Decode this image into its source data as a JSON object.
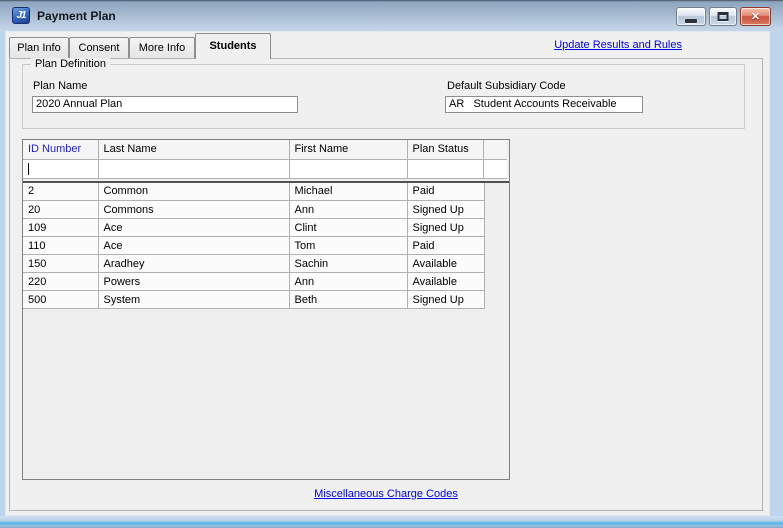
{
  "window": {
    "title": "Payment Plan",
    "app_icon_text": "J1",
    "controls": {
      "minimize": "minimize-icon",
      "maximize": "maximize-icon",
      "close_glyph": "✕"
    }
  },
  "tabs": [
    {
      "label": "Plan Info",
      "selected": false
    },
    {
      "label": "Consent",
      "selected": false
    },
    {
      "label": "More Info",
      "selected": false
    },
    {
      "label": "Students",
      "selected": true
    }
  ],
  "links": {
    "update_results_and_rules": "Update Results and Rules",
    "miscellaneous_charge_codes": "Miscellaneous Charge Codes"
  },
  "plan_definition": {
    "group_title": "Plan Definition",
    "plan_name_label": "Plan Name",
    "plan_name_value": "2020 Annual Plan",
    "subsidiary_label": "Default Subsidiary Code",
    "subsidiary_value": "AR   Student Accounts Receivable"
  },
  "students_grid": {
    "columns": [
      "ID Number",
      "Last Name",
      "First Name",
      "Plan Status"
    ],
    "sorted_column": "ID Number",
    "filter_values": [
      "",
      "",
      "",
      ""
    ],
    "rows": [
      [
        "2",
        "Common",
        "Michael",
        "Paid"
      ],
      [
        "20",
        "Commons",
        "Ann",
        "Signed Up"
      ],
      [
        "109",
        "Ace",
        "Clint",
        "Signed Up"
      ],
      [
        "110",
        "Ace",
        "Tom",
        "Paid"
      ],
      [
        "150",
        "Aradhey",
        "Sachin",
        "Available"
      ],
      [
        "220",
        "Powers",
        "Ann",
        "Available"
      ],
      [
        "500",
        "System",
        "Beth",
        "Signed Up"
      ]
    ]
  },
  "colors": {
    "form_background": "#f0f0f0",
    "frame_blue": "#bdd5ec",
    "link_blue": "#0000e8",
    "sorted_header_blue": "#2222cc",
    "close_button_red": "#d05a45",
    "grid_border": "#7f7f7f"
  }
}
